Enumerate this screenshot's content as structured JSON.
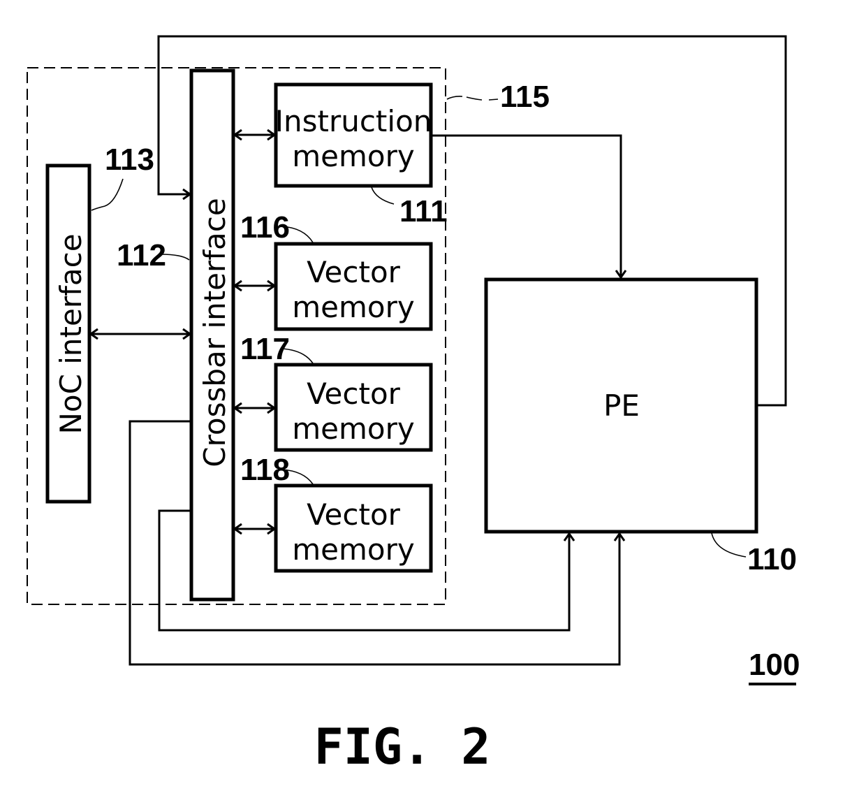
{
  "figure": {
    "caption": "FIG. 2",
    "system_ref": "100"
  },
  "blocks": {
    "noc_interface": {
      "label": "NoC interface",
      "ref": "113"
    },
    "crossbar_interface": {
      "label": "Crossbar interface",
      "ref": "112"
    },
    "instruction_memory": {
      "line1": "Instruction",
      "line2": "memory",
      "ref": "111"
    },
    "vector_memory_1": {
      "line1": "Vector",
      "line2": "memory",
      "ref": "116"
    },
    "vector_memory_2": {
      "line1": "Vector",
      "line2": "memory",
      "ref": "117"
    },
    "vector_memory_3": {
      "line1": "Vector",
      "line2": "memory",
      "ref": "118"
    },
    "pe": {
      "label": "PE",
      "ref": "110"
    },
    "memory_group": {
      "ref": "115"
    }
  }
}
